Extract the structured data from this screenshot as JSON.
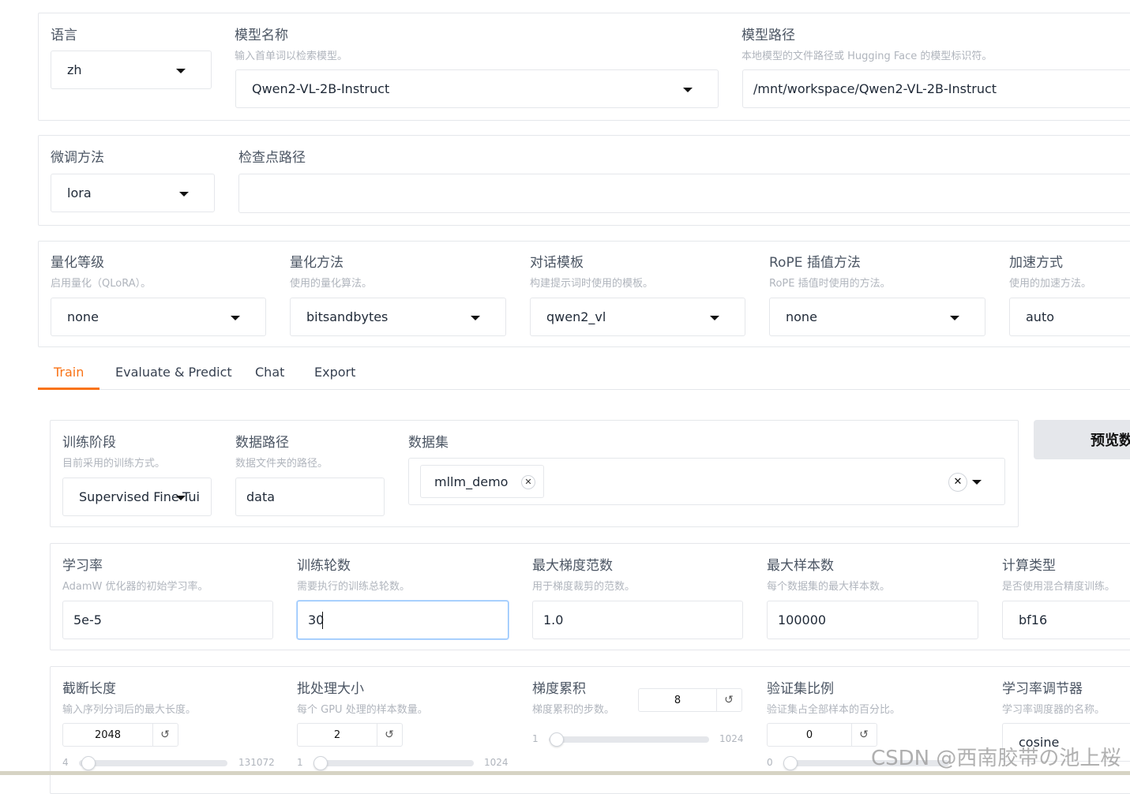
{
  "top": {
    "lang": {
      "label": "语言",
      "value": "zh"
    },
    "model_name": {
      "label": "模型名称",
      "hint": "输入首单词以检索模型。",
      "value": "Qwen2-VL-2B-Instruct"
    },
    "model_path": {
      "label": "模型路径",
      "hint": "本地模型的文件路径或 Hugging Face 的模型标识符。",
      "value": "/mnt/workspace/Qwen2-VL-2B-Instruct"
    }
  },
  "finetune": {
    "method": {
      "label": "微调方法",
      "value": "lora"
    },
    "checkpoint": {
      "label": "检查点路径",
      "value": ""
    }
  },
  "advanced": {
    "quant_bit": {
      "label": "量化等级",
      "hint": "启用量化（QLoRA）。",
      "value": "none"
    },
    "quant_method": {
      "label": "量化方法",
      "hint": "使用的量化算法。",
      "value": "bitsandbytes"
    },
    "template": {
      "label": "对话模板",
      "hint": "构建提示词时使用的模板。",
      "value": "qwen2_vl"
    },
    "rope": {
      "label": "RoPE 插值方法",
      "hint": "RoPE 插值时使用的方法。",
      "value": "none"
    },
    "booster": {
      "label": "加速方式",
      "hint": "使用的加速方法。",
      "value": "auto"
    }
  },
  "tabs": [
    "Train",
    "Evaluate & Predict",
    "Chat",
    "Export"
  ],
  "train": {
    "stage": {
      "label": "训练阶段",
      "hint": "目前采用的训练方式。",
      "value": "Supervised Fine-Tui"
    },
    "dataset_dir": {
      "label": "数据路径",
      "hint": "数据文件夹的路径。",
      "value": "data"
    },
    "dataset": {
      "label": "数据集",
      "chip": "mllm_demo"
    },
    "preview_button": "预览数",
    "lr": {
      "label": "学习率",
      "hint": "AdamW 优化器的初始学习率。",
      "value": "5e-5"
    },
    "epochs": {
      "label": "训练轮数",
      "hint": "需要执行的训练总轮数。",
      "value": "30"
    },
    "max_grad_norm": {
      "label": "最大梯度范数",
      "hint": "用于梯度裁剪的范数。",
      "value": "1.0"
    },
    "max_samples": {
      "label": "最大样本数",
      "hint": "每个数据集的最大样本数。",
      "value": "100000"
    },
    "compute_type": {
      "label": "计算类型",
      "hint": "是否使用混合精度训练。",
      "value": "bf16"
    },
    "cutoff_len": {
      "label": "截断长度",
      "hint": "输入序列分词后的最大长度。",
      "value": "2048",
      "min": "4",
      "max": "131072",
      "fraction": 0.0156
    },
    "batch_size": {
      "label": "批处理大小",
      "hint": "每个 GPU 处理的样本数量。",
      "value": "2",
      "min": "1",
      "max": "1024",
      "fraction": 0.001
    },
    "grad_accum": {
      "label": "梯度累积",
      "hint": "梯度累积的步数。",
      "value": "8",
      "min": "1",
      "max": "1024",
      "fraction": 0.007
    },
    "val_size": {
      "label": "验证集比例",
      "hint": "验证集占全部样本的百分比。",
      "value": "0",
      "min": "0",
      "fraction": 0.0
    },
    "lr_scheduler": {
      "label": "学习率调节器",
      "hint": "学习率调度器的名称。",
      "value": "cosine"
    }
  },
  "watermark": "CSDN @西南胶带の池上桜",
  "colors": {
    "accent": "#f97316",
    "border": "#e5e7eb",
    "hint": "#b0b5bd"
  },
  "icons": {
    "dropdown": "chevron-down-icon",
    "reset": "reset-icon",
    "clear": "clear-icon"
  }
}
